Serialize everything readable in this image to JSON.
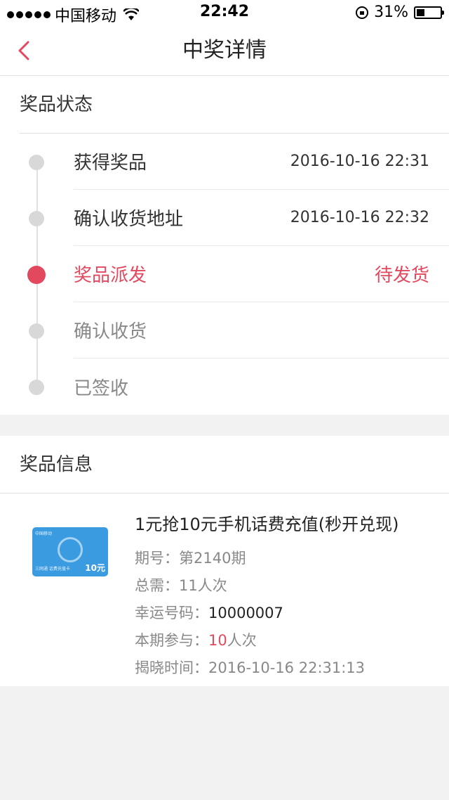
{
  "status_bar": {
    "carrier": "中国移动",
    "time": "22:42",
    "battery": "31%",
    "battery_level": 0.31
  },
  "nav": {
    "title": "中奖详情"
  },
  "status_section": {
    "title": "奖品状态",
    "steps": [
      {
        "label": "获得奖品",
        "value": "2016-10-16 22:31",
        "state": "done"
      },
      {
        "label": "确认收货地址",
        "value": "2016-10-16 22:32",
        "state": "done"
      },
      {
        "label": "奖品派发",
        "value": "待发货",
        "state": "active"
      },
      {
        "label": "确认收货",
        "value": "",
        "state": "pending"
      },
      {
        "label": "已签收",
        "value": "",
        "state": "pending"
      }
    ]
  },
  "info_section": {
    "title": "奖品信息",
    "card": {
      "top_text": "中国移动",
      "side_text": "三网通 话费充值卡",
      "face_value": "10元"
    },
    "prize_title": "1元抢10元手机话费充值(秒开兑现)",
    "rows": {
      "period_label": "期号：",
      "period_value": "第2140期",
      "total_label": "总需：",
      "total_value": "11人次",
      "lucky_label": "幸运号码：",
      "lucky_value": "10000007",
      "joined_label": "本期参与：",
      "joined_count": "10",
      "joined_unit": "人次",
      "reveal_label": "揭晓时间：",
      "reveal_value": "2016-10-16 22:31:13"
    }
  },
  "colors": {
    "accent": "#e2485e",
    "dot_inactive": "#d8d8d8",
    "background": "#f2f2f2"
  }
}
